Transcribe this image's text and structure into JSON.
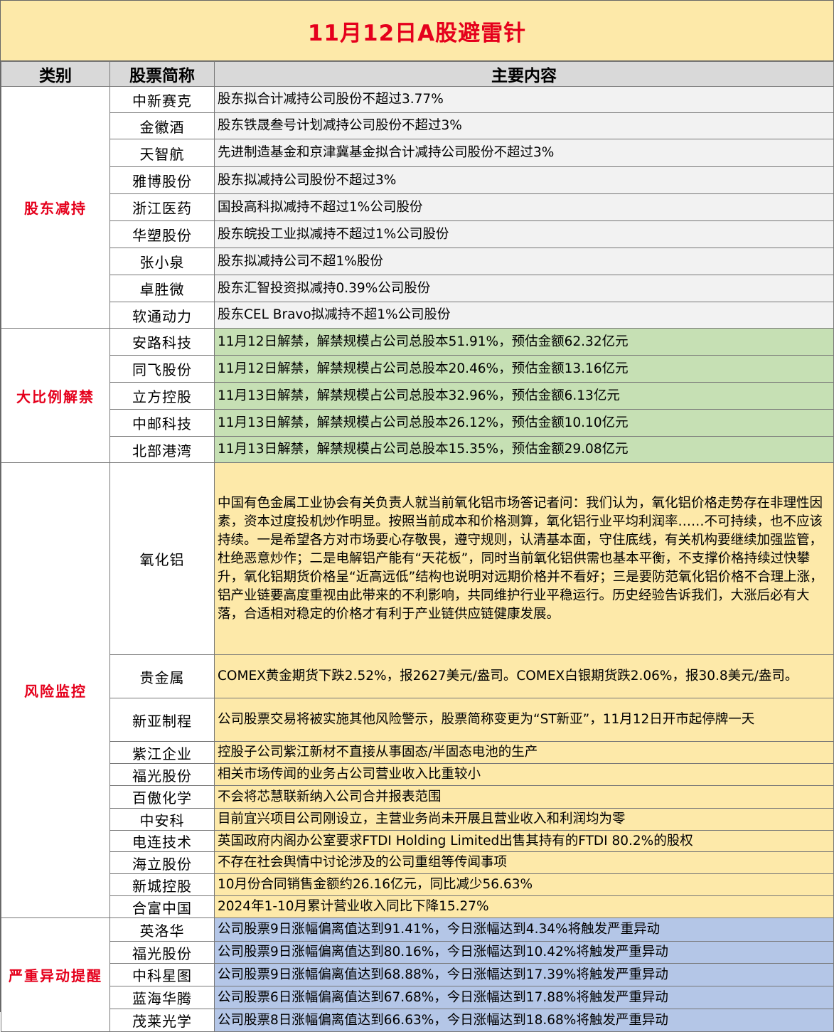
{
  "title": "11月12日A股避雷针",
  "headers": {
    "category": "类别",
    "stock": "股票简称",
    "content": "主要内容"
  },
  "sections": [
    {
      "category": "股东减持",
      "rows": [
        {
          "name": "中新赛克",
          "content": "股东拟合计减持公司股份不超过3.77%"
        },
        {
          "name": "金徽酒",
          "content": "股东铁晟叁号计划减持公司股份不超过3%"
        },
        {
          "name": "天智航",
          "content": "先进制造基金和京津冀基金拟合计减持公司股份不超过3%"
        },
        {
          "name": "雅博股份",
          "content": "股东拟减持公司股份不超过3%"
        },
        {
          "name": "浙江医药",
          "content": "国投高科拟减持不超过1%公司股份"
        },
        {
          "name": "华塑股份",
          "content": "股东皖投工业拟减持不超过1%公司股份"
        },
        {
          "name": "张小泉",
          "content": "股东拟减持公司不超1%股份"
        },
        {
          "name": "卓胜微",
          "content": "股东汇智投资拟减持0.39%公司股份"
        },
        {
          "name": "软通动力",
          "content": "股东CEL Bravo拟减持不超1%公司股份"
        }
      ]
    },
    {
      "category": "大比例解禁",
      "rows": [
        {
          "name": "安路科技",
          "content": "11月12日解禁，解禁规模占公司总股本51.91%，预估金额62.32亿元"
        },
        {
          "name": "同飞股份",
          "content": "11月12日解禁，解禁规模占公司总股本20.46%，预估金额13.16亿元"
        },
        {
          "name": "立方控股",
          "content": "11月13日解禁，解禁规模占公司总股本32.96%，预估金额6.13亿元"
        },
        {
          "name": "中邮科技",
          "content": "11月13日解禁，解禁规模占公司总股本26.12%，预估金额10.10亿元"
        },
        {
          "name": "北部港湾",
          "content": "11月13日解禁，解禁规模占公司总股本15.35%，预估金额29.08亿元"
        }
      ]
    },
    {
      "category": "风险监控",
      "rows": [
        {
          "name": "氧化铝",
          "content": "中国有色金属工业协会有关负责人就当前氧化铝市场答记者问：我们认为，氧化铝价格走势存在非理性因素，资本过度投机炒作明显。按照当前成本和价格测算，氧化铝行业平均利润率……不可持续，也不应该持续。一是希望各方对市场要心存敬畏，遵守规则，认清基本面，守住底线，有关机构要继续加强监管，杜绝恶意炒作；二是电解铝产能有“天花板”，同时当前氧化铝供需也基本平衡，不支撑价格持续过快攀升，氧化铝期货价格呈“近高远低”结构也说明对远期价格并不看好；三是要防范氧化铝价格不合理上涨，铝产业链要高度重视由此带来的不利影响，共同维护行业平稳运行。历史经验告诉我们，大涨后必有大落，合适相对稳定的价格才有利于产业链供应链健康发展。"
        },
        {
          "name": "贵金属",
          "content": "COMEX黄金期货下跌2.52%，报2627美元/盎司。COMEX白银期货跌2.06%，报30.8美元/盎司。"
        },
        {
          "name": "新亚制程",
          "content": "公司股票交易将被实施其他风险警示，股票简称变更为“ST新亚”，11月12日开市起停牌一天"
        },
        {
          "name": "紫江企业",
          "content": "控股子公司紫江新材不直接从事固态/半固态电池的生产"
        },
        {
          "name": "福光股份",
          "content": "相关市场传闻的业务占公司营业收入比重较小"
        },
        {
          "name": "百傲化学",
          "content": "不会将芯慧联新纳入公司合并报表范围"
        },
        {
          "name": "中安科",
          "content": "目前宜兴项目公司刚设立，主营业务尚未开展且营业收入和利润均为零"
        },
        {
          "name": "电连技术",
          "content": "英国政府内阁办公室要求FTDI Holding Limited出售其持有的FTDI 80.2%的股权"
        },
        {
          "name": "海立股份",
          "content": "不存在社会舆情中讨论涉及的公司重组等传闻事项"
        },
        {
          "name": "新城控股",
          "content": "10月份合同销售金额约26.16亿元，同比减少56.63%"
        },
        {
          "name": "合富中国",
          "content": "2024年1-10月累计营业收入同比下降15.27%"
        }
      ]
    },
    {
      "category": "严重异动提醒",
      "rows": [
        {
          "name": "英洛华",
          "content": "公司股票9日涨幅偏离值达到91.41%，今日涨幅达到4.34%将触发严重异动"
        },
        {
          "name": "福光股份",
          "content": "公司股票9日涨幅偏离值达到80.16%，今日涨幅达到10.42%将触发严重异动"
        },
        {
          "name": "中科星图",
          "content": "公司股票9日涨幅偏离值达到68.88%，今日涨幅达到17.39%将触发严重异动"
        },
        {
          "name": "蓝海华腾",
          "content": "公司股票6日涨幅偏离值达到67.68%，今日涨幅达到17.88%将触发严重异动"
        },
        {
          "name": "茂莱光学",
          "content": "公司股票8日涨幅偏离值达到66.63%，今日涨幅达到18.68%将触发严重异动"
        }
      ]
    }
  ]
}
